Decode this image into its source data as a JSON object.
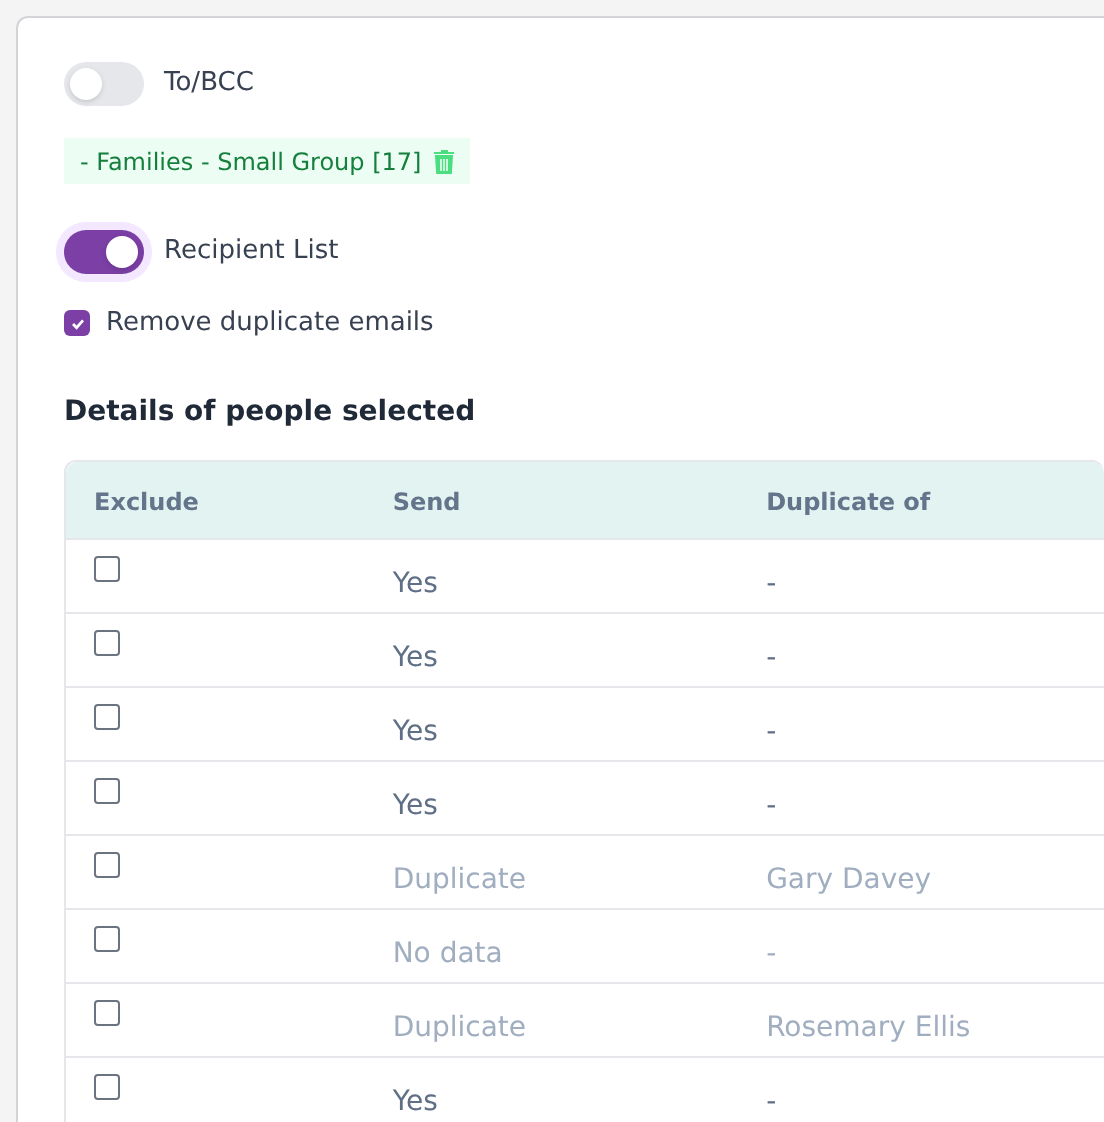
{
  "to_bcc": {
    "label": "To/BCC",
    "on": false
  },
  "chip": {
    "label": "- Families - Small Group [17]"
  },
  "recipient_list": {
    "label": "Recipient List",
    "on": true
  },
  "remove_duplicates": {
    "label": "Remove duplicate emails",
    "checked": true
  },
  "heading": "Details of people selected",
  "table": {
    "columns": [
      "Exclude",
      "Send",
      "Duplicate of"
    ],
    "rows": [
      {
        "excluded": false,
        "send": "Yes",
        "duplicate_of": "-",
        "greyed": false
      },
      {
        "excluded": false,
        "send": "Yes",
        "duplicate_of": "-",
        "greyed": false
      },
      {
        "excluded": false,
        "send": "Yes",
        "duplicate_of": "-",
        "greyed": false
      },
      {
        "excluded": false,
        "send": "Yes",
        "duplicate_of": "-",
        "greyed": false
      },
      {
        "excluded": false,
        "send": "Duplicate",
        "duplicate_of": "Gary Davey",
        "greyed": true
      },
      {
        "excluded": false,
        "send": "No data",
        "duplicate_of": "-",
        "greyed": true
      },
      {
        "excluded": false,
        "send": "Duplicate",
        "duplicate_of": "Rosemary Ellis",
        "greyed": true
      },
      {
        "excluded": false,
        "send": "Yes",
        "duplicate_of": "-",
        "greyed": false
      }
    ]
  }
}
